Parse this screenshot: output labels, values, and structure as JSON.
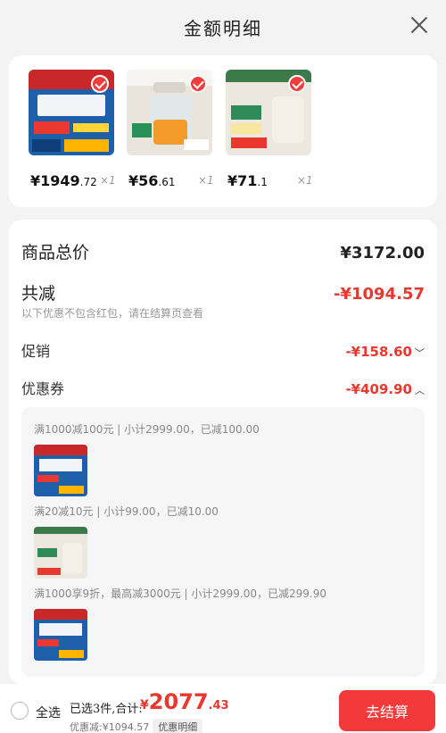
{
  "header": {
    "title": "金额明细"
  },
  "products": [
    {
      "price_int": "¥1949",
      "price_dec": ".72",
      "qty": "×1"
    },
    {
      "price_int": "¥56",
      "price_dec": ".61",
      "qty": "×1"
    },
    {
      "price_int": "¥71",
      "price_dec": ".1",
      "qty": "×1"
    }
  ],
  "summary": {
    "total_label": "商品总价",
    "total_value": "¥3172.00",
    "discount_label": "共减",
    "discount_value": "-¥1094.57",
    "note": "以下优惠不包含红包，请在结算页查看",
    "promo_label": "促销",
    "promo_value": "-¥158.60",
    "coupon_label": "优惠券",
    "coupon_value": "-¥409.90"
  },
  "coupons": [
    {
      "text": "满1000减100元 | 小计2999.00，已减100.00"
    },
    {
      "text": "满20减10元 | 小计99.00，已减10.00"
    },
    {
      "text": "满1000享9折，最高减3000元 | 小计2999.00，已减299.90"
    }
  ],
  "footer": {
    "select_all": "全选",
    "selected_text": "已选3件,合计:",
    "total_symbol": "¥",
    "total_int": "2077",
    "total_dec": ".43",
    "discount_text": "优惠减:¥1094.57",
    "detail_tag": "优惠明细",
    "checkout": "去结算"
  },
  "colors": {
    "accent": "#e8382f",
    "button": "#f23a3a"
  }
}
